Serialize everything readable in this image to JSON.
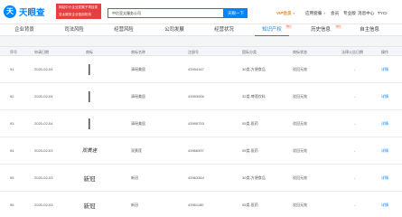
{
  "brand": {
    "logo_glyph": "天",
    "name": "天眼查"
  },
  "promo": {
    "line1": "网站中小企业发展子项目奖",
    "line2": "亚太服务企业信用机构"
  },
  "search": {
    "value": "中亿亚太服务公司",
    "button": "天眼一下"
  },
  "top_nav": {
    "vip": "VIP会员",
    "enterprise": "应用套餐",
    "more": "会员",
    "business": "专业版",
    "msg": "消息中心",
    "user": "TYCI"
  },
  "tabs": [
    {
      "label": "企业背景"
    },
    {
      "label": "司法风险"
    },
    {
      "label": "经营风险"
    },
    {
      "label": "公司发展"
    },
    {
      "label": "经营状况"
    },
    {
      "label": "知识产权"
    },
    {
      "label": "历史信息"
    },
    {
      "label": "自主信息"
    }
  ],
  "tab_badges": [
    "99+",
    "99+"
  ],
  "table": {
    "headers": [
      "序号",
      "申请日期",
      "商标",
      "商标名称",
      "注册号",
      "国际分类",
      "商标状态",
      "法律公告日期",
      "操作"
    ],
    "rows": [
      {
        "idx": "91",
        "date": "2020-02-04",
        "mark": "vertical",
        "name": "清瑶美居",
        "reg": "43994167",
        "cls": "30类-方便食品",
        "status": "驳回无效",
        "legal": "-",
        "op": "详情"
      },
      {
        "idx": "92",
        "date": "2020-02-04",
        "mark": "vertical",
        "name": "清瑶美居",
        "reg": "43993066",
        "cls": "32类-啤酒饮料",
        "status": "驳回无效",
        "legal": "-",
        "op": "详情"
      },
      {
        "idx": "93",
        "date": "2020-02-04",
        "mark": "vertical",
        "name": "清瑶美居",
        "reg": "43995753",
        "cls": "05类-医药",
        "status": "驳回无效",
        "legal": "-",
        "op": "详情"
      },
      {
        "idx": "94",
        "date": "2020-02-03",
        "mark": "script",
        "mark_text": "双黄连",
        "name": "双黄莲",
        "reg": "43966397",
        "cls": "05类-医药",
        "status": "驳回无效",
        "legal": "-",
        "op": "详情"
      },
      {
        "idx": "95",
        "date": "2020-02-03",
        "mark": "chars",
        "mark_text": "新冠",
        "name": "新冠",
        "reg": "43963364",
        "cls": "30类-方便食品",
        "status": "驳回无效",
        "legal": "-",
        "op": "详情"
      },
      {
        "idx": "96",
        "date": "2020-02-03",
        "mark": "chars",
        "mark_text": "新冠",
        "name": "新冠",
        "reg": "43961180",
        "cls": "05类-医药",
        "status": "驳回无效",
        "legal": "-",
        "op": "详情"
      }
    ]
  }
}
